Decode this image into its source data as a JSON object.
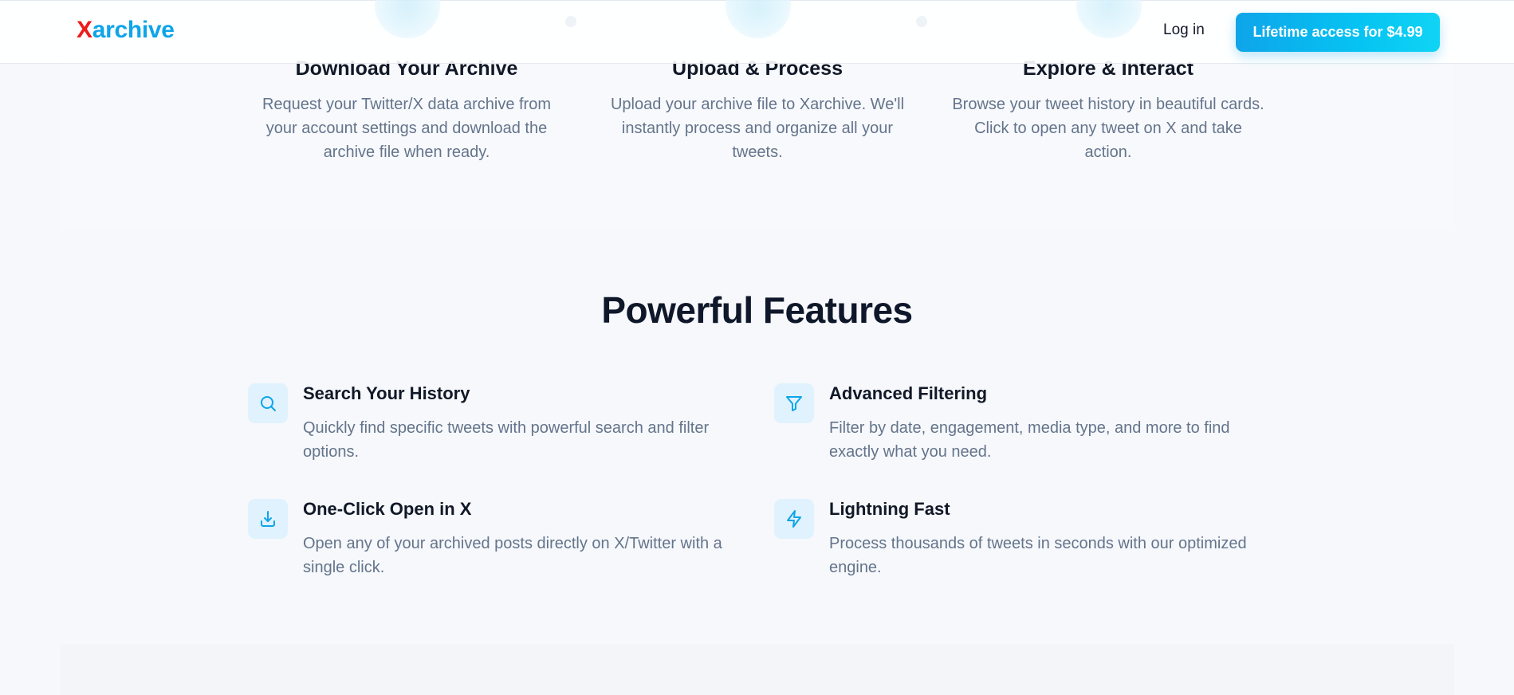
{
  "header": {
    "logo_x": "X",
    "logo_rest": "archive",
    "login_label": "Log in",
    "cta_label": "Lifetime access for $4.99"
  },
  "steps": [
    {
      "title": "Download Your Archive",
      "description": "Request your Twitter/X data archive from your account settings and download the archive file when ready."
    },
    {
      "title": "Upload & Process",
      "description": "Upload your archive file to Xarchive. We'll instantly process and organize all your tweets."
    },
    {
      "title": "Explore & Interact",
      "description": "Browse your tweet history in beautiful cards. Click to open any tweet on X and take action."
    }
  ],
  "features": {
    "title": "Powerful Features",
    "items": [
      {
        "icon": "search-icon",
        "title": "Search Your History",
        "description": "Quickly find specific tweets with powerful search and filter options."
      },
      {
        "icon": "filter-icon",
        "title": "Advanced Filtering",
        "description": "Filter by date, engagement, media type, and more to find exactly what you need."
      },
      {
        "icon": "download-icon",
        "title": "One-Click Open in X",
        "description": "Open any of your archived posts directly on X/Twitter with a single click."
      },
      {
        "icon": "lightning-icon",
        "title": "Lightning Fast",
        "description": "Process thousands of tweets in seconds with our optimized engine."
      }
    ]
  },
  "colors": {
    "accent": "#0ea5e9",
    "logo_x": "#ef1b1b",
    "heading": "#0f172a",
    "muted_text": "#64748b",
    "icon_bg": "#e0f2fe"
  }
}
